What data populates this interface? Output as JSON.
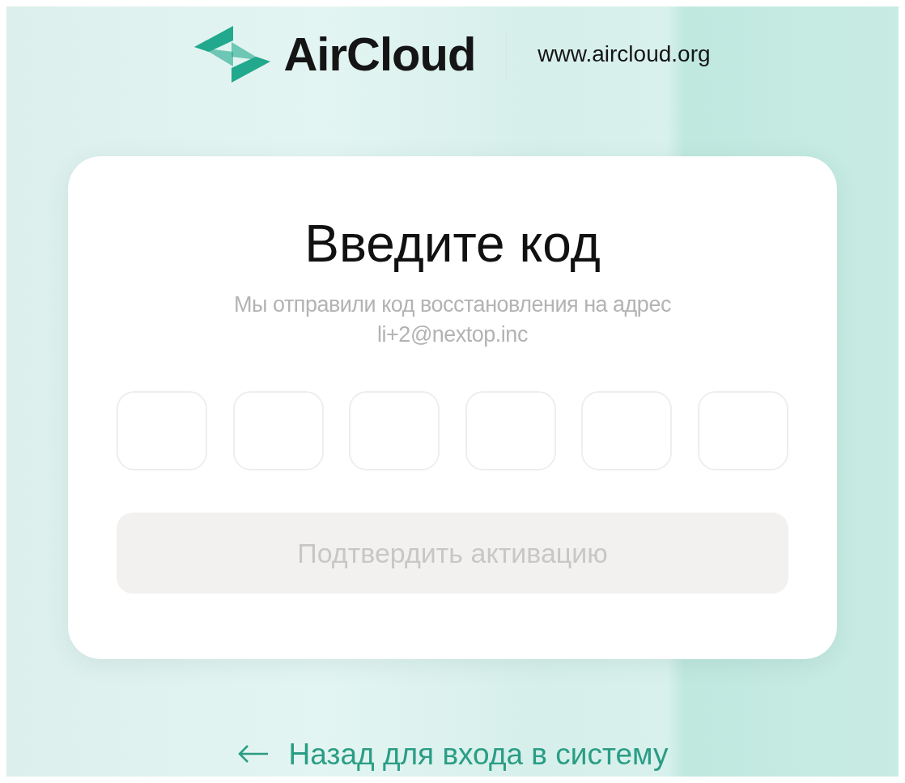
{
  "header": {
    "brand": "AirCloud",
    "website": "www.aircloud.org"
  },
  "card": {
    "title": "Введите код",
    "message": "Мы отправили код восстановления на адрес",
    "email": "li+2@nextop.inc",
    "code_fields": [
      {
        "kind": "digit"
      },
      {
        "kind": "digit"
      },
      {
        "kind": "digit"
      },
      {
        "kind": "digit"
      },
      {
        "kind": "digit"
      },
      {
        "kind": "digit"
      }
    ],
    "submit_button": {
      "label": "Подтвердить активацию",
      "disabled": true
    }
  },
  "back_link": {
    "label": "Назад для входа в систему"
  }
}
